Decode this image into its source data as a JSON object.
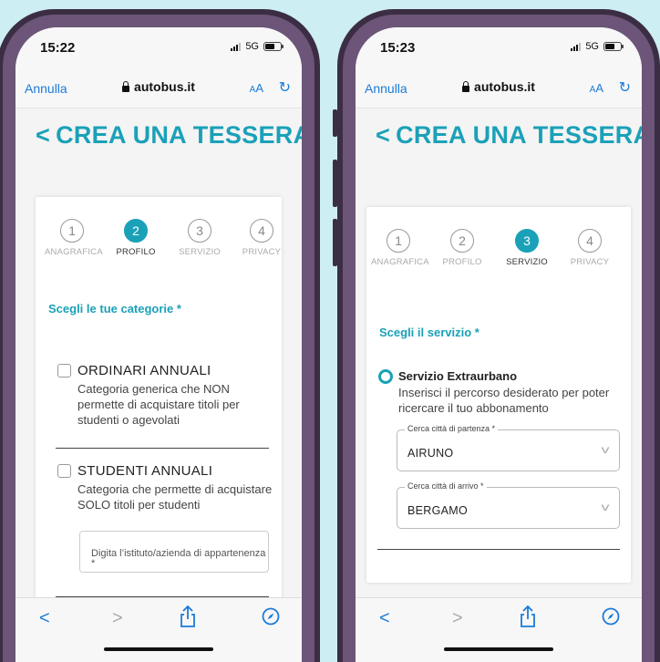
{
  "left_phone": {
    "status": {
      "time": "15:22",
      "network": "5G"
    },
    "browser": {
      "cancel": "Annulla",
      "url": "autobus.it",
      "text_size_small": "A",
      "text_size_large": "A",
      "reload_icon": "reload-icon"
    },
    "page": {
      "title": "CREA UNA TESSERA"
    },
    "steps": [
      {
        "num": "1",
        "label": "ANAGRAFICA"
      },
      {
        "num": "2",
        "label": "PROFILO"
      },
      {
        "num": "3",
        "label": "SERVIZIO"
      },
      {
        "num": "4",
        "label": "PRIVACY"
      }
    ],
    "active_step": 2,
    "section_title": "Scegli le tue categorie *",
    "categories": [
      {
        "title": "ORDINARI ANNUALI",
        "description": "Categoria generica che NON permette di acquistare titoli per studenti o agevolati",
        "checked": false
      },
      {
        "title": "STUDENTI ANNUALI",
        "description": "Categoria che permette di acquistare SOLO titoli per studenti",
        "checked": false
      }
    ],
    "institute_field": {
      "placeholder": "Digita l’istituto/azienda di appartenenza *"
    }
  },
  "right_phone": {
    "status": {
      "time": "15:23",
      "network": "5G"
    },
    "browser": {
      "cancel": "Annulla",
      "url": "autobus.it",
      "text_size_small": "A",
      "text_size_large": "A",
      "reload_icon": "reload-icon"
    },
    "page": {
      "title": "CREA UNA TESSERA"
    },
    "steps": [
      {
        "num": "1",
        "label": "ANAGRAFICA"
      },
      {
        "num": "2",
        "label": "PROFILO"
      },
      {
        "num": "3",
        "label": "SERVIZIO"
      },
      {
        "num": "4",
        "label": "PRIVACY"
      }
    ],
    "active_step": 3,
    "section_title": "Scegli il servizio *",
    "service": {
      "title": "Servizio Extraurbano",
      "description": "Inserisci il percorso desiderato per poter ricercare il tuo abbonamento",
      "selected": true
    },
    "departure": {
      "label": "Cerca città di partenza *",
      "value": "AIRUNO"
    },
    "arrival": {
      "label": "Cerca città di arrivo *",
      "value": "BERGAMO"
    }
  },
  "toolbar_icons": [
    "back-icon",
    "forward-icon",
    "share-icon",
    "compass-icon"
  ],
  "colors": {
    "accent": "#1aa1b8",
    "link": "#1a7bd9",
    "background": "#cdeef3",
    "frame": "#3b2d43"
  }
}
